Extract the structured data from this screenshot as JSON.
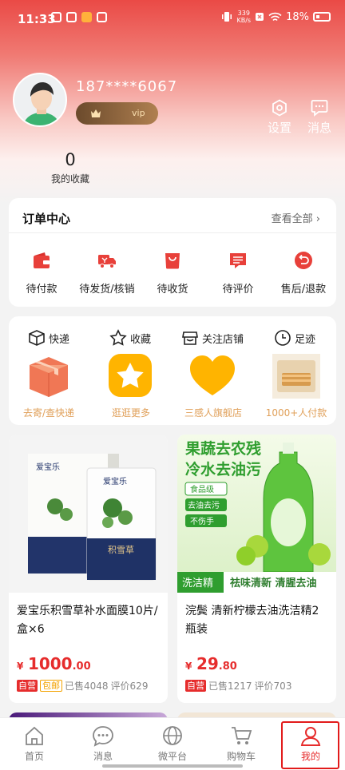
{
  "status_bar": {
    "time": "11:33",
    "net_speed_top": "339",
    "net_speed_unit": "KB/s",
    "battery": "18%"
  },
  "profile": {
    "phone": "187****6067",
    "vip_label": "vip"
  },
  "header_actions": [
    {
      "label": "设置",
      "icon": "gear-icon"
    },
    {
      "label": "消息",
      "icon": "chat-icon"
    }
  ],
  "favorites": {
    "count": "0",
    "label": "我的收藏"
  },
  "orders": {
    "title": "订单中心",
    "view_all": "查看全部 ›",
    "items": [
      {
        "label": "待付款",
        "icon": "wallet-icon"
      },
      {
        "label": "待发货/核销",
        "icon": "truck-icon"
      },
      {
        "label": "待收货",
        "icon": "bag-icon"
      },
      {
        "label": "待评价",
        "icon": "comment-icon"
      },
      {
        "label": "售后/退款",
        "icon": "refund-icon"
      }
    ]
  },
  "quick_links": [
    {
      "label": "快递",
      "footer": "去寄/查快递",
      "icon": "box-icon"
    },
    {
      "label": "收藏",
      "footer": "逛逛更多",
      "icon": "star-icon"
    },
    {
      "label": "关注店铺",
      "footer": "三感人旗舰店",
      "icon": "store-icon"
    },
    {
      "label": "足迹",
      "footer": "1000+人付款",
      "icon": "clock-icon"
    }
  ],
  "products": [
    {
      "title": "爱宝乐积雪草补水面膜10片/盒×6",
      "currency": "¥",
      "price_int": "1000",
      "price_dec": ".00",
      "tags": [
        "自营",
        "包邮"
      ],
      "sold": "已售4048",
      "reviews": "评价629",
      "image_brand": "爱宝乐",
      "image_text": "积雪草"
    },
    {
      "title": "浣鬓 清新柠檬去油洗洁精2瓶装",
      "currency": "¥",
      "price_int": "29",
      "price_dec": ".80",
      "tags": [
        "自营"
      ],
      "sold": "已售1217",
      "reviews": "评价703",
      "image_headline_1": "果蔬去农残",
      "image_headline_2": "冷水去油污",
      "image_badges": [
        "食品级",
        "去油去污",
        "不伤手"
      ],
      "image_bottom_left": "洗洁精",
      "image_bottom_right": "祛味清新 清腥去油"
    }
  ],
  "nav": [
    {
      "label": "首页",
      "icon": "home-icon"
    },
    {
      "label": "消息",
      "icon": "chat-bubble-icon"
    },
    {
      "label": "微平台",
      "icon": "globe-icon"
    },
    {
      "label": "购物车",
      "icon": "cart-icon"
    },
    {
      "label": "我的",
      "icon": "person-icon"
    }
  ],
  "colors": {
    "accent": "#e62c2c",
    "header": "#ea4a46",
    "quick_footer": "#e0a05a"
  }
}
